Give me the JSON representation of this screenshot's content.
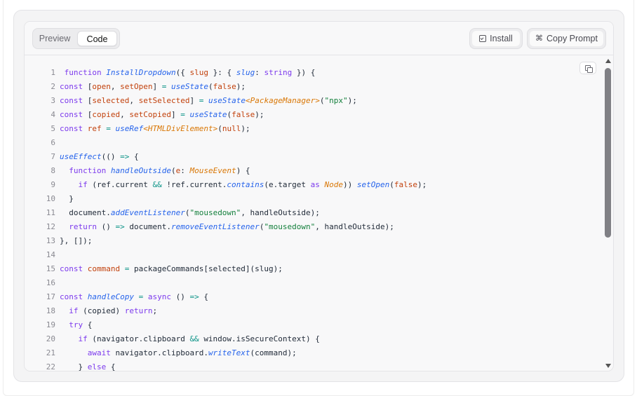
{
  "tabs": [
    {
      "label": "Preview",
      "active": false
    },
    {
      "label": "Code",
      "active": true
    }
  ],
  "actions": {
    "install_label": "Install",
    "copy_prompt_label": "Copy Prompt",
    "install_icon": "terminal-icon",
    "copy_prompt_icon": "command-icon"
  },
  "colors": {
    "keyword": "#7c3aed",
    "function": "#2563eb",
    "string": "#15803d",
    "literal": "#c2410c",
    "type": "#d97706",
    "operator": "#0d9488"
  },
  "code_lines": [
    {
      "n": "1",
      "tokens": [
        [
          "kw",
          " function "
        ],
        [
          "fn",
          "InstallDropdown"
        ],
        [
          "id",
          "({ "
        ],
        [
          "var",
          "slug"
        ],
        [
          "id",
          " }: { "
        ],
        [
          "fn",
          "slug"
        ],
        [
          "id",
          ": "
        ],
        [
          "kw",
          "string"
        ],
        [
          "id",
          " }) {"
        ]
      ]
    },
    {
      "n": "2",
      "tokens": [
        [
          "kw",
          "const "
        ],
        [
          "id",
          "["
        ],
        [
          "var",
          "open"
        ],
        [
          "id",
          ", "
        ],
        [
          "var",
          "setOpen"
        ],
        [
          "id",
          "] "
        ],
        [
          "op",
          "= "
        ],
        [
          "fn",
          "useState"
        ],
        [
          "id",
          "("
        ],
        [
          "bool",
          "false"
        ],
        [
          "id",
          ");"
        ]
      ]
    },
    {
      "n": "3",
      "tokens": [
        [
          "kw",
          "const "
        ],
        [
          "id",
          "["
        ],
        [
          "var",
          "selected"
        ],
        [
          "id",
          ", "
        ],
        [
          "var",
          "setSelected"
        ],
        [
          "id",
          "] "
        ],
        [
          "op",
          "= "
        ],
        [
          "fn",
          "useState"
        ],
        [
          "type",
          "<PackageManager>"
        ],
        [
          "id",
          "("
        ],
        [
          "str",
          "\"npx\""
        ],
        [
          "id",
          ");"
        ]
      ]
    },
    {
      "n": "4",
      "tokens": [
        [
          "kw",
          "const "
        ],
        [
          "id",
          "["
        ],
        [
          "var",
          "copied"
        ],
        [
          "id",
          ", "
        ],
        [
          "var",
          "setCopied"
        ],
        [
          "id",
          "] "
        ],
        [
          "op",
          "= "
        ],
        [
          "fn",
          "useState"
        ],
        [
          "id",
          "("
        ],
        [
          "bool",
          "false"
        ],
        [
          "id",
          ");"
        ]
      ]
    },
    {
      "n": "5",
      "tokens": [
        [
          "kw",
          "const "
        ],
        [
          "var",
          "ref "
        ],
        [
          "op",
          "= "
        ],
        [
          "fn",
          "useRef"
        ],
        [
          "type",
          "<HTMLDivElement>"
        ],
        [
          "id",
          "("
        ],
        [
          "bool",
          "null"
        ],
        [
          "id",
          ");"
        ]
      ]
    },
    {
      "n": "6",
      "tokens": []
    },
    {
      "n": "7",
      "tokens": [
        [
          "fn",
          "useEffect"
        ],
        [
          "id",
          "(() "
        ],
        [
          "op",
          "=> "
        ],
        [
          "id",
          "{"
        ]
      ]
    },
    {
      "n": "8",
      "tokens": [
        [
          "kw",
          "  function "
        ],
        [
          "fn",
          "handleOutside"
        ],
        [
          "id",
          "("
        ],
        [
          "var",
          "e"
        ],
        [
          "id",
          ": "
        ],
        [
          "type",
          "MouseEvent"
        ],
        [
          "id",
          ") {"
        ]
      ]
    },
    {
      "n": "9",
      "tokens": [
        [
          "kw",
          "    if "
        ],
        [
          "id",
          "(ref.current "
        ],
        [
          "op",
          "&& "
        ],
        [
          "id",
          "!ref.current."
        ],
        [
          "fn",
          "contains"
        ],
        [
          "id",
          "(e.target "
        ],
        [
          "kw",
          "as "
        ],
        [
          "type",
          "Node"
        ],
        [
          "id",
          ")) "
        ],
        [
          "fn",
          "setOpen"
        ],
        [
          "id",
          "("
        ],
        [
          "bool",
          "false"
        ],
        [
          "id",
          ");"
        ]
      ]
    },
    {
      "n": "10",
      "tokens": [
        [
          "id",
          "  }"
        ]
      ]
    },
    {
      "n": "11",
      "tokens": [
        [
          "id",
          "  document."
        ],
        [
          "fn",
          "addEventListener"
        ],
        [
          "id",
          "("
        ],
        [
          "str",
          "\"mousedown\""
        ],
        [
          "id",
          ", handleOutside);"
        ]
      ]
    },
    {
      "n": "12",
      "tokens": [
        [
          "kw",
          "  return "
        ],
        [
          "id",
          "() "
        ],
        [
          "op",
          "=> "
        ],
        [
          "id",
          "document."
        ],
        [
          "fn",
          "removeEventListener"
        ],
        [
          "id",
          "("
        ],
        [
          "str",
          "\"mousedown\""
        ],
        [
          "id",
          ", handleOutside);"
        ]
      ]
    },
    {
      "n": "13",
      "tokens": [
        [
          "id",
          "}, []);"
        ]
      ]
    },
    {
      "n": "14",
      "tokens": []
    },
    {
      "n": "15",
      "tokens": [
        [
          "kw",
          "const "
        ],
        [
          "var",
          "command "
        ],
        [
          "op",
          "= "
        ],
        [
          "id",
          "packageCommands[selected](slug);"
        ]
      ]
    },
    {
      "n": "16",
      "tokens": []
    },
    {
      "n": "17",
      "tokens": [
        [
          "kw",
          "const "
        ],
        [
          "fn",
          "handleCopy "
        ],
        [
          "op",
          "= "
        ],
        [
          "kw",
          "async "
        ],
        [
          "id",
          "() "
        ],
        [
          "op",
          "=> "
        ],
        [
          "id",
          "{"
        ]
      ]
    },
    {
      "n": "18",
      "tokens": [
        [
          "kw",
          "  if "
        ],
        [
          "id",
          "(copied) "
        ],
        [
          "kw",
          "return"
        ],
        [
          "id",
          ";"
        ]
      ]
    },
    {
      "n": "19",
      "tokens": [
        [
          "kw",
          "  try "
        ],
        [
          "id",
          "{"
        ]
      ]
    },
    {
      "n": "20",
      "tokens": [
        [
          "kw",
          "    if "
        ],
        [
          "id",
          "(navigator.clipboard "
        ],
        [
          "op",
          "&& "
        ],
        [
          "id",
          "window.isSecureContext) {"
        ]
      ]
    },
    {
      "n": "21",
      "tokens": [
        [
          "kw",
          "      await "
        ],
        [
          "id",
          "navigator.clipboard."
        ],
        [
          "fn",
          "writeText"
        ],
        [
          "id",
          "(command);"
        ]
      ]
    },
    {
      "n": "22",
      "tokens": [
        [
          "id",
          "    } "
        ],
        [
          "kw",
          "else "
        ],
        [
          "id",
          "{"
        ]
      ]
    }
  ]
}
